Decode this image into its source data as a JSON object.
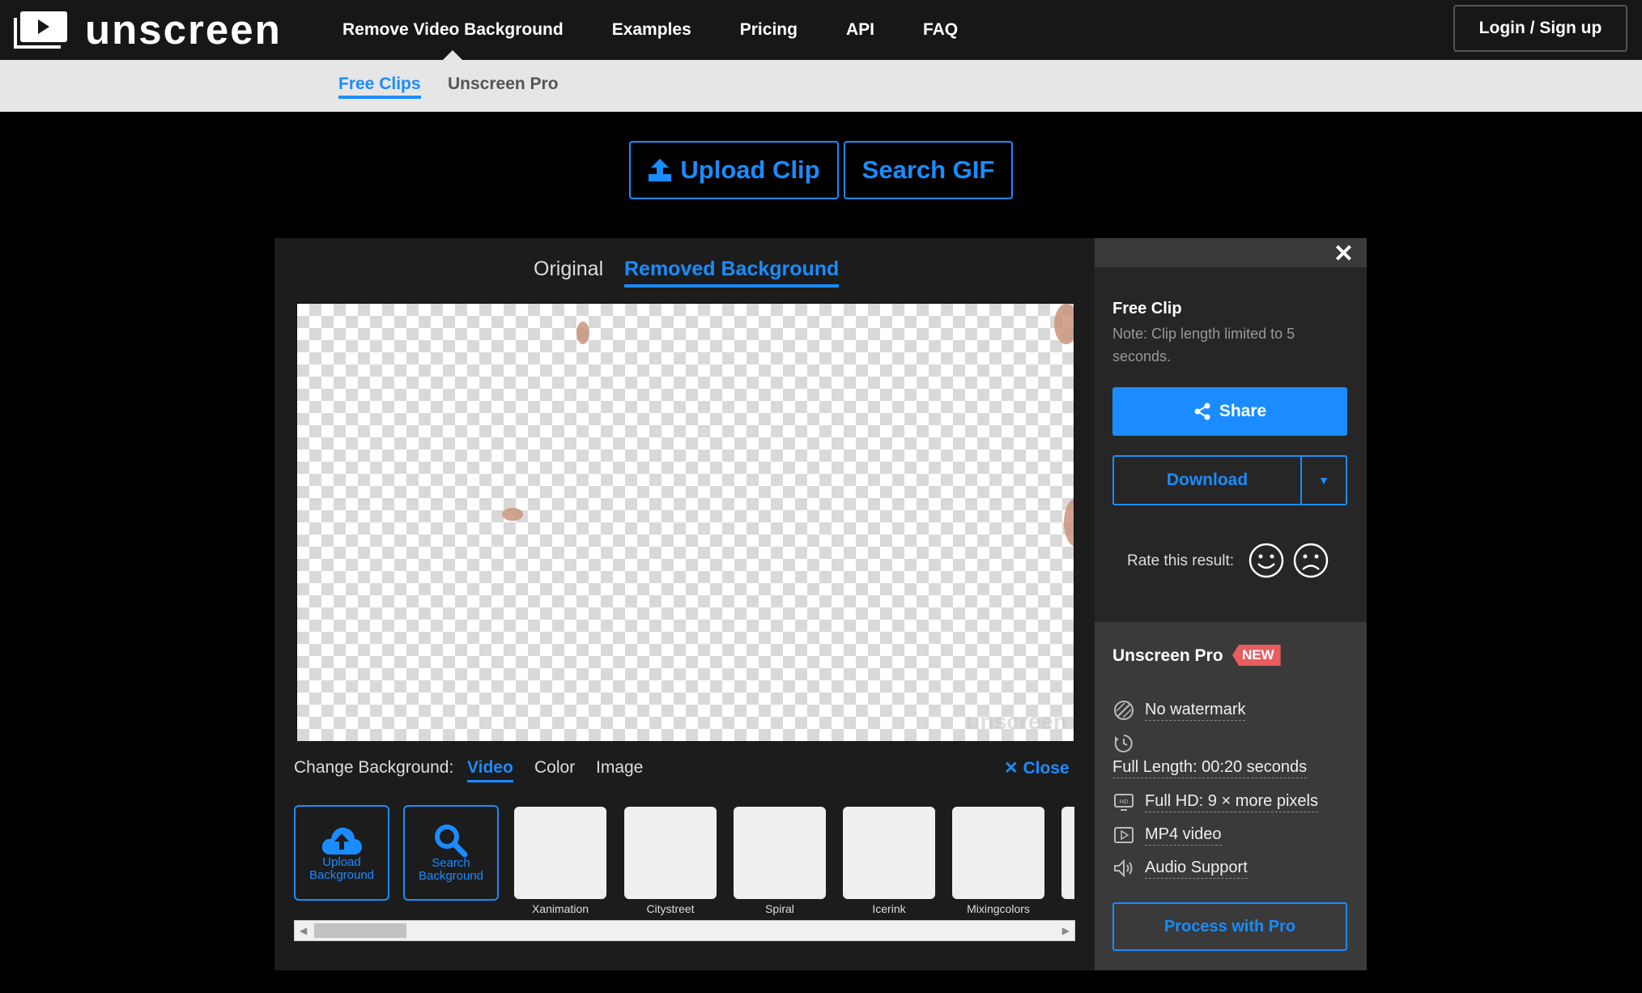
{
  "brand": {
    "name": "unscreen"
  },
  "nav": {
    "items": [
      "Remove Video Background",
      "Examples",
      "Pricing",
      "API",
      "FAQ"
    ],
    "login": "Login / Sign up"
  },
  "subnav": {
    "items": [
      "Free Clips",
      "Unscreen Pro"
    ]
  },
  "actions": {
    "upload": "Upload Clip",
    "search": "Search GIF"
  },
  "editor": {
    "tabs": [
      "Original",
      "Removed Background"
    ],
    "watermark": "unscreen",
    "change_label": "Change Background:",
    "bg_tabs": [
      "Video",
      "Color",
      "Image"
    ],
    "close": "Close",
    "upload_bg": "Upload Background",
    "search_bg": "Search Background",
    "thumbnails": [
      "Xanimation",
      "Citystreet",
      "Spiral",
      "Icerink",
      "Mixingcolors"
    ]
  },
  "side": {
    "free_title": "Free Clip",
    "free_note": "Note: Clip length limited to 5 seconds.",
    "share": "Share",
    "download": "Download",
    "rate": "Rate this result:",
    "pro_title": "Unscreen Pro",
    "new_badge": "NEW",
    "features": [
      "No watermark",
      "Full Length: 00:20 seconds",
      "Full HD: 9 × more pixels",
      "MP4 video",
      "Audio Support"
    ],
    "pro_button": "Process with Pro"
  },
  "colors": {
    "accent": "#1a8cff",
    "badge": "#e85d5d"
  }
}
